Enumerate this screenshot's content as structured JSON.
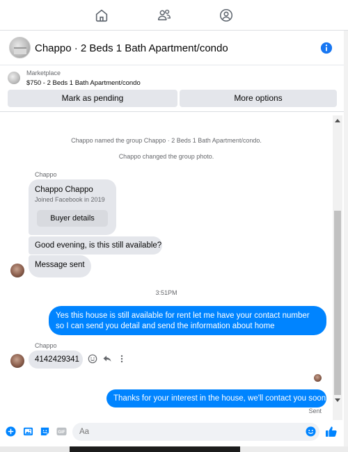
{
  "nav": {
    "icons": [
      "home-icon",
      "people-icon",
      "profile-icon"
    ]
  },
  "header": {
    "title": "Chappo · 2 Beds 1 Bath Apartment/condo"
  },
  "marketplace": {
    "label": "Marketplace",
    "listing": "$750 - 2 Beds 1 Bath Apartment/condo",
    "mark_pending": "Mark as pending",
    "more_options": "More options"
  },
  "messages": {
    "system_1": "Chappo named the group Chappo · 2 Beds 1 Bath Apartment/condo.",
    "system_2": "Chappo changed the group photo.",
    "sender_1": "Chappo",
    "card_name": "Chappo Chappo",
    "card_joined": "Joined Facebook in 2019",
    "buyer_details": "Buyer details",
    "msg_1": "Good evening, is this still available?",
    "msg_2": "Message sent",
    "time_1": "3:51PM",
    "out_1": "Yes this house is still available for rent let me have your contact number so I can send you detail and send the information about home",
    "sender_2": "Chappo",
    "msg_3": "4142429341",
    "out_2": "Thanks for your interest in the house, we'll contact you soon",
    "status": "Sent"
  },
  "composer": {
    "placeholder": "Aa"
  },
  "colors": {
    "accent": "#0084ff",
    "bubble_in": "#e4e6eb",
    "secondary_text": "#65676b"
  }
}
